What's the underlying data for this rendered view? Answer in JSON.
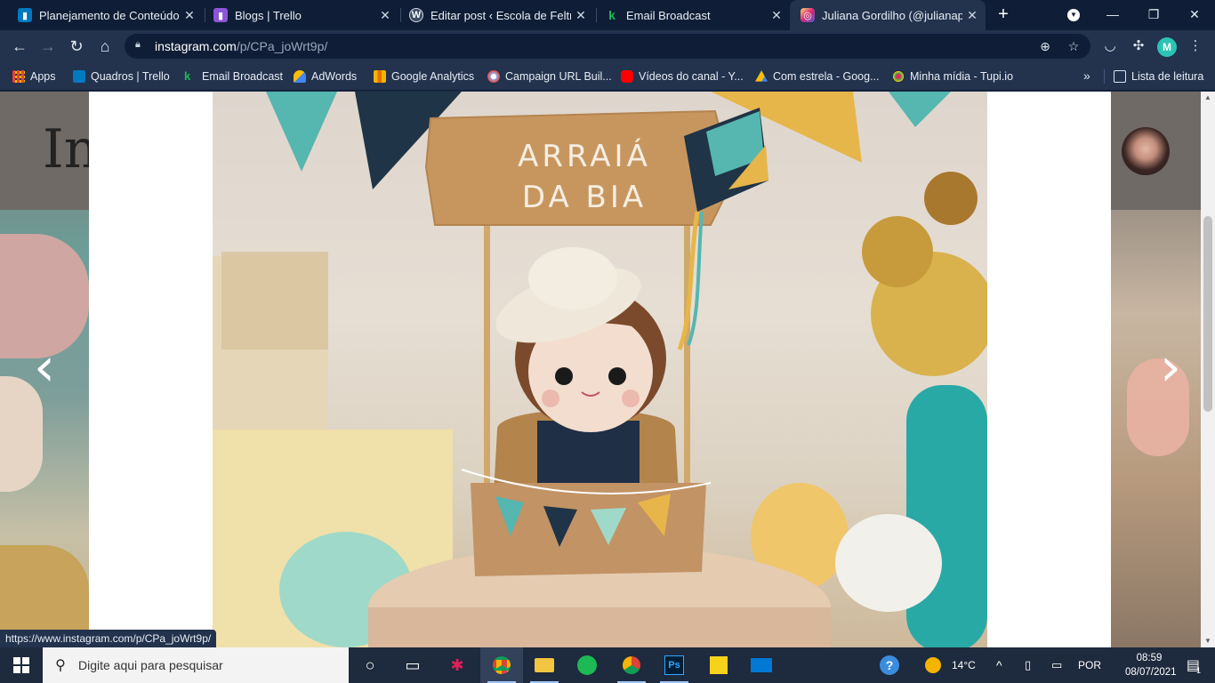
{
  "tabs": [
    {
      "title": "Planejamento de Conteúdo |",
      "favicon": "trello-icon",
      "color": "#0079bf",
      "active": false
    },
    {
      "title": "Blogs | Trello",
      "favicon": "trello-icon",
      "color": "#8c54d6",
      "active": false
    },
    {
      "title": "Editar post ‹ Escola de Feltro",
      "favicon": "wordpress-icon",
      "color": "#3c4b66",
      "active": false
    },
    {
      "title": "Email Broadcast",
      "favicon": "k-icon",
      "color": "#1db954",
      "active": false
    },
    {
      "title": "Juliana Gordilho (@julianapg",
      "favicon": "instagram-icon",
      "color": "#d6336c",
      "active": true
    }
  ],
  "address": {
    "host": "instagram.com",
    "path": "/p/CPa_joWrt9p/"
  },
  "profile_initial": "M",
  "bookmarks": [
    {
      "label": "Apps",
      "icon": "apps-grid-icon",
      "color": "#ea4335"
    },
    {
      "label": "Quadros | Trello",
      "icon": "trello-icon",
      "color": "#0079bf"
    },
    {
      "label": "Email Broadcast",
      "icon": "k-icon",
      "color": "#1db954"
    },
    {
      "label": "AdWords",
      "icon": "adwords-icon",
      "color": "#4285f4"
    },
    {
      "label": "Google Analytics",
      "icon": "analytics-icon",
      "color": "#f4b400"
    },
    {
      "label": "Campaign URL Buil...",
      "icon": "campaign-icon",
      "color": "#8ab4f8"
    },
    {
      "label": "Vídeos do canal - Y...",
      "icon": "youtube-icon",
      "color": "#ff0000"
    },
    {
      "label": "Com estrela - Goog...",
      "icon": "drive-icon",
      "color": "#fbbc04"
    },
    {
      "label": "Minha mídia - Tupi.io",
      "icon": "tupi-icon",
      "color": "#e91e63"
    }
  ],
  "reading_list_label": "Lista de leitura",
  "photo": {
    "sign_line1": "ARRAIÁ",
    "sign_line2": "DA BIA"
  },
  "status_url": "https://www.instagram.com/p/CPa_joWrt9p/",
  "taskbar": {
    "search_placeholder": "Digite aqui para pesquisar",
    "weather": "14°C",
    "language": "POR",
    "time": "08:59",
    "date": "08/07/2021",
    "notifications": "1"
  }
}
